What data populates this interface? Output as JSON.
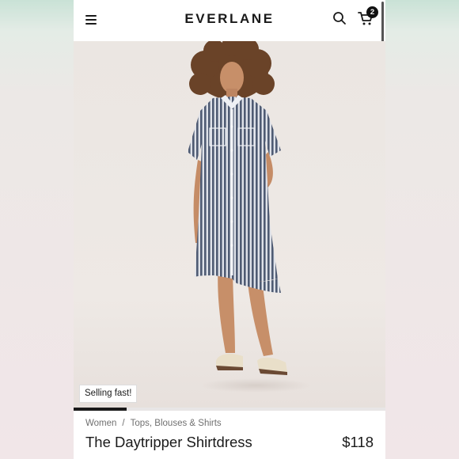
{
  "header": {
    "brand": "EVERLANE",
    "menu_icon": "hamburger-menu-icon",
    "search_icon": "search-icon",
    "cart_icon": "shopping-cart-icon",
    "cart_count": "2"
  },
  "product": {
    "badge": "Selling fast!",
    "gallery_progress_fraction": 0.17,
    "breadcrumb": [
      "Women",
      "Tops, Blouses & Shirts"
    ],
    "breadcrumb_separator": "/",
    "name": "The Daytripper Shirtdress",
    "price": "$118"
  },
  "colors": {
    "accent": "#111111",
    "dress_stripe": "#4f5b73",
    "background": "#ffffff"
  }
}
